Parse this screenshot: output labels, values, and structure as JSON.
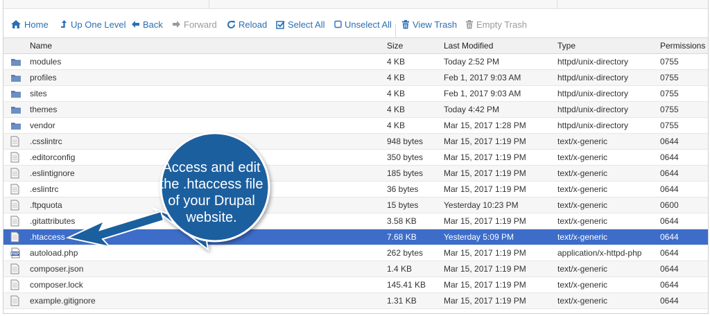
{
  "toolbar": {
    "home": "Home",
    "up_one_level": "Up One Level",
    "back": "Back",
    "forward": "Forward",
    "reload": "Reload",
    "select_all": "Select All",
    "unselect_all": "Unselect All",
    "view_trash": "View Trash",
    "empty_trash": "Empty Trash"
  },
  "columns": {
    "name": "Name",
    "size": "Size",
    "last_modified": "Last Modified",
    "type": "Type",
    "permissions": "Permissions"
  },
  "files": [
    {
      "icon": "folder-icon",
      "name": "modules",
      "size": "4 KB",
      "modified": "Today 2:52 PM",
      "type": "httpd/unix-directory",
      "perm": "0755"
    },
    {
      "icon": "folder-icon",
      "name": "profiles",
      "size": "4 KB",
      "modified": "Feb 1, 2017 9:03 AM",
      "type": "httpd/unix-directory",
      "perm": "0755"
    },
    {
      "icon": "folder-icon",
      "name": "sites",
      "size": "4 KB",
      "modified": "Feb 1, 2017 9:03 AM",
      "type": "httpd/unix-directory",
      "perm": "0755"
    },
    {
      "icon": "folder-icon",
      "name": "themes",
      "size": "4 KB",
      "modified": "Today 4:42 PM",
      "type": "httpd/unix-directory",
      "perm": "0755"
    },
    {
      "icon": "folder-icon",
      "name": "vendor",
      "size": "4 KB",
      "modified": "Mar 15, 2017 1:28 PM",
      "type": "httpd/unix-directory",
      "perm": "0755"
    },
    {
      "icon": "file-icon",
      "name": ".csslintrc",
      "size": "948 bytes",
      "modified": "Mar 15, 2017 1:19 PM",
      "type": "text/x-generic",
      "perm": "0644"
    },
    {
      "icon": "file-icon",
      "name": ".editorconfig",
      "size": "350 bytes",
      "modified": "Mar 15, 2017 1:19 PM",
      "type": "text/x-generic",
      "perm": "0644"
    },
    {
      "icon": "file-icon",
      "name": ".eslintignore",
      "size": "185 bytes",
      "modified": "Mar 15, 2017 1:19 PM",
      "type": "text/x-generic",
      "perm": "0644"
    },
    {
      "icon": "file-icon",
      "name": ".eslintrc",
      "size": "36 bytes",
      "modified": "Mar 15, 2017 1:19 PM",
      "type": "text/x-generic",
      "perm": "0644"
    },
    {
      "icon": "file-icon",
      "name": ".ftpquota",
      "size": "15 bytes",
      "modified": "Yesterday 10:23 PM",
      "type": "text/x-generic",
      "perm": "0600"
    },
    {
      "icon": "file-icon",
      "name": ".gitattributes",
      "size": "3.58 KB",
      "modified": "Mar 15, 2017 1:19 PM",
      "type": "text/x-generic",
      "perm": "0644"
    },
    {
      "icon": "file-icon",
      "name": ".htaccess",
      "size": "7.68 KB",
      "modified": "Yesterday 5:09 PM",
      "type": "text/x-generic",
      "perm": "0644",
      "selected": true
    },
    {
      "icon": "php-file-icon",
      "name": "autoload.php",
      "size": "262 bytes",
      "modified": "Mar 15, 2017 1:19 PM",
      "type": "application/x-httpd-php",
      "perm": "0644"
    },
    {
      "icon": "file-icon",
      "name": "composer.json",
      "size": "1.4 KB",
      "modified": "Mar 15, 2017 1:19 PM",
      "type": "text/x-generic",
      "perm": "0644"
    },
    {
      "icon": "file-icon",
      "name": "composer.lock",
      "size": "145.41 KB",
      "modified": "Mar 15, 2017 1:19 PM",
      "type": "text/x-generic",
      "perm": "0644"
    },
    {
      "icon": "file-icon",
      "name": "example.gitignore",
      "size": "1.31 KB",
      "modified": "Mar 15, 2017 1:19 PM",
      "type": "text/x-generic",
      "perm": "0644"
    }
  ],
  "callout": {
    "line1": "Access and edit",
    "line2": "the .htaccess file",
    "line3": "of your Drupal",
    "line4": "website."
  },
  "colors": {
    "accent": "#2a6fb5",
    "selected_row": "#3d6dc9",
    "callout_fill": "#1a5f9e",
    "folder": "#5b7fb4"
  }
}
